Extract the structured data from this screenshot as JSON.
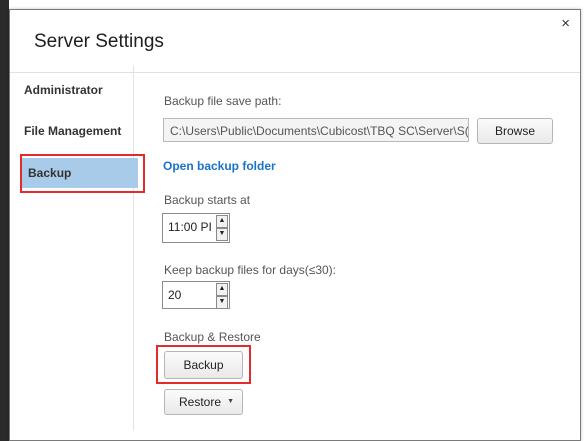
{
  "dialog": {
    "title": "Server Settings",
    "close_icon": "×"
  },
  "sidebar": {
    "items": [
      {
        "label": "Administrator"
      },
      {
        "label": "File Management"
      },
      {
        "label": "Backup",
        "active": true
      }
    ]
  },
  "backup": {
    "save_path_label": "Backup file save path:",
    "save_path_value": "C:\\Users\\Public\\Documents\\Cubicost\\TBQ SC\\Server\\S(",
    "browse_label": "Browse",
    "open_folder_link": "Open backup folder",
    "starts_at_label": "Backup starts at",
    "starts_at_value": "11:00 PI",
    "keep_days_label": "Keep backup files for days(≤30):",
    "keep_days_value": "20",
    "backup_restore_label": "Backup & Restore",
    "backup_button_label": "Backup",
    "restore_button_label": "Restore",
    "spin_up": "▲",
    "spin_down": "▼",
    "dropdown_arrow": "▼"
  },
  "colors": {
    "active_nav_bg": "#a9cbea",
    "highlight_red": "#e32b2b",
    "link_blue": "#1a73c9"
  }
}
